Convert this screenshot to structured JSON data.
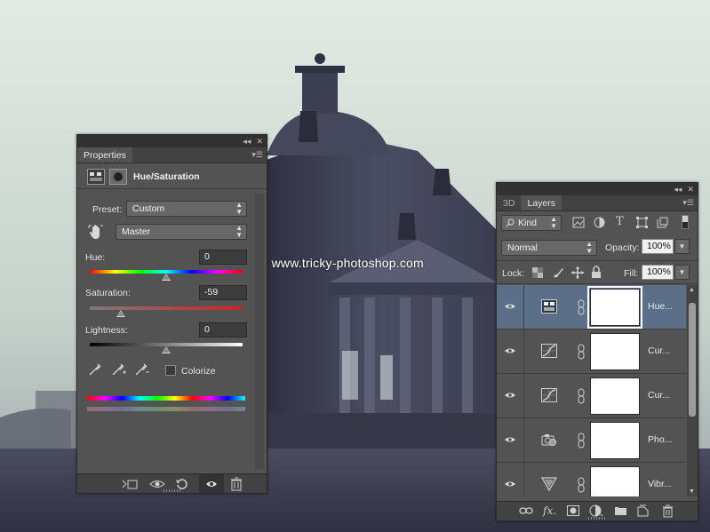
{
  "watermark": "© www.tricky-photoshop.com",
  "properties": {
    "tab": "Properties",
    "adjustment_title": "Hue/Saturation",
    "preset_label": "Preset:",
    "preset_value": "Custom",
    "channel_value": "Master",
    "hue_label": "Hue:",
    "hue_value": "0",
    "hue_fraction": 0.5,
    "saturation_label": "Saturation:",
    "saturation_value": "-59",
    "saturation_fraction": 0.205,
    "lightness_label": "Lightness:",
    "lightness_value": "0",
    "lightness_fraction": 0.5,
    "colorize_label": "Colorize",
    "colorize_checked": false,
    "footer_icons": [
      "clip-to-layer-icon",
      "view-previous-icon",
      "reset-icon",
      "visibility-icon",
      "trash-icon"
    ]
  },
  "layers": {
    "tabs": [
      "3D",
      "Layers"
    ],
    "active_tab": "Layers",
    "filter_kind": "Kind",
    "blend_mode": "Normal",
    "opacity_label": "Opacity:",
    "opacity_value": "100%",
    "lock_label": "Lock:",
    "fill_label": "Fill:",
    "fill_value": "100%",
    "rows": [
      {
        "name": "Hue...",
        "type": "hue-saturation",
        "selected": true
      },
      {
        "name": "Cur...",
        "type": "curves",
        "selected": false
      },
      {
        "name": "Cur...",
        "type": "curves",
        "selected": false
      },
      {
        "name": "Pho...",
        "type": "photo-filter",
        "selected": false
      },
      {
        "name": "Vibr...",
        "type": "vibrance",
        "selected": false
      }
    ],
    "footer_icons": [
      "link-icon",
      "fx-icon",
      "add-mask-icon",
      "new-adjustment-icon",
      "new-group-icon",
      "new-layer-icon",
      "trash-icon"
    ]
  },
  "colors": {
    "panel_bg": "#535353",
    "selected_row": "#5c6f88",
    "sky": "#d2ddd5",
    "building": "#3a3c4c"
  }
}
